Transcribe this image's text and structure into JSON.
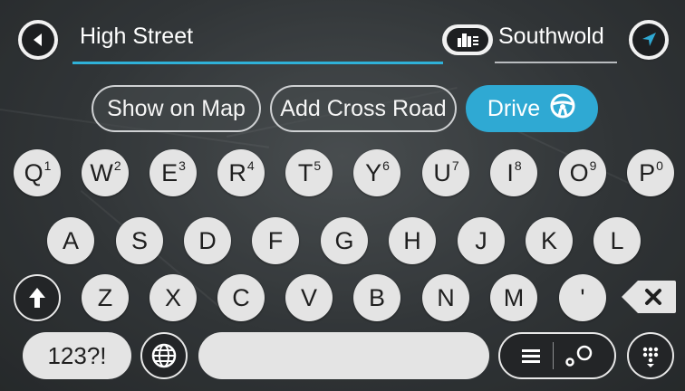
{
  "search": {
    "value": "High Street"
  },
  "city": {
    "value": "Southwold"
  },
  "actions": {
    "show_on_map": "Show on Map",
    "add_cross_road": "Add Cross Road",
    "drive": "Drive"
  },
  "keyboard": {
    "row1": [
      {
        "label": "Q",
        "alt": "1"
      },
      {
        "label": "W",
        "alt": "2"
      },
      {
        "label": "E",
        "alt": "3"
      },
      {
        "label": "R",
        "alt": "4"
      },
      {
        "label": "T",
        "alt": "5"
      },
      {
        "label": "Y",
        "alt": "6"
      },
      {
        "label": "U",
        "alt": "7"
      },
      {
        "label": "I",
        "alt": "8"
      },
      {
        "label": "O",
        "alt": "9"
      },
      {
        "label": "P",
        "alt": "0"
      }
    ],
    "row2": [
      "A",
      "S",
      "D",
      "F",
      "G",
      "H",
      "J",
      "K",
      "L"
    ],
    "row3": [
      "Z",
      "X",
      "C",
      "V",
      "B",
      "N",
      "M",
      "'"
    ],
    "numbers_label": "123?!"
  },
  "icons": {
    "back": "back-arrow-icon",
    "city": "city-buildings-icon",
    "location": "navigation-arrow-icon",
    "drive": "steering-wheel-icon",
    "shift": "shift-arrow-icon",
    "backspace": "backspace-icon",
    "globe": "globe-icon",
    "list_map": "list-map-toggle-icon",
    "keyboard": "keyboard-icon"
  },
  "colors": {
    "accent": "#2fa9d3",
    "key": "#e4e4e4",
    "dark": "#232527"
  }
}
